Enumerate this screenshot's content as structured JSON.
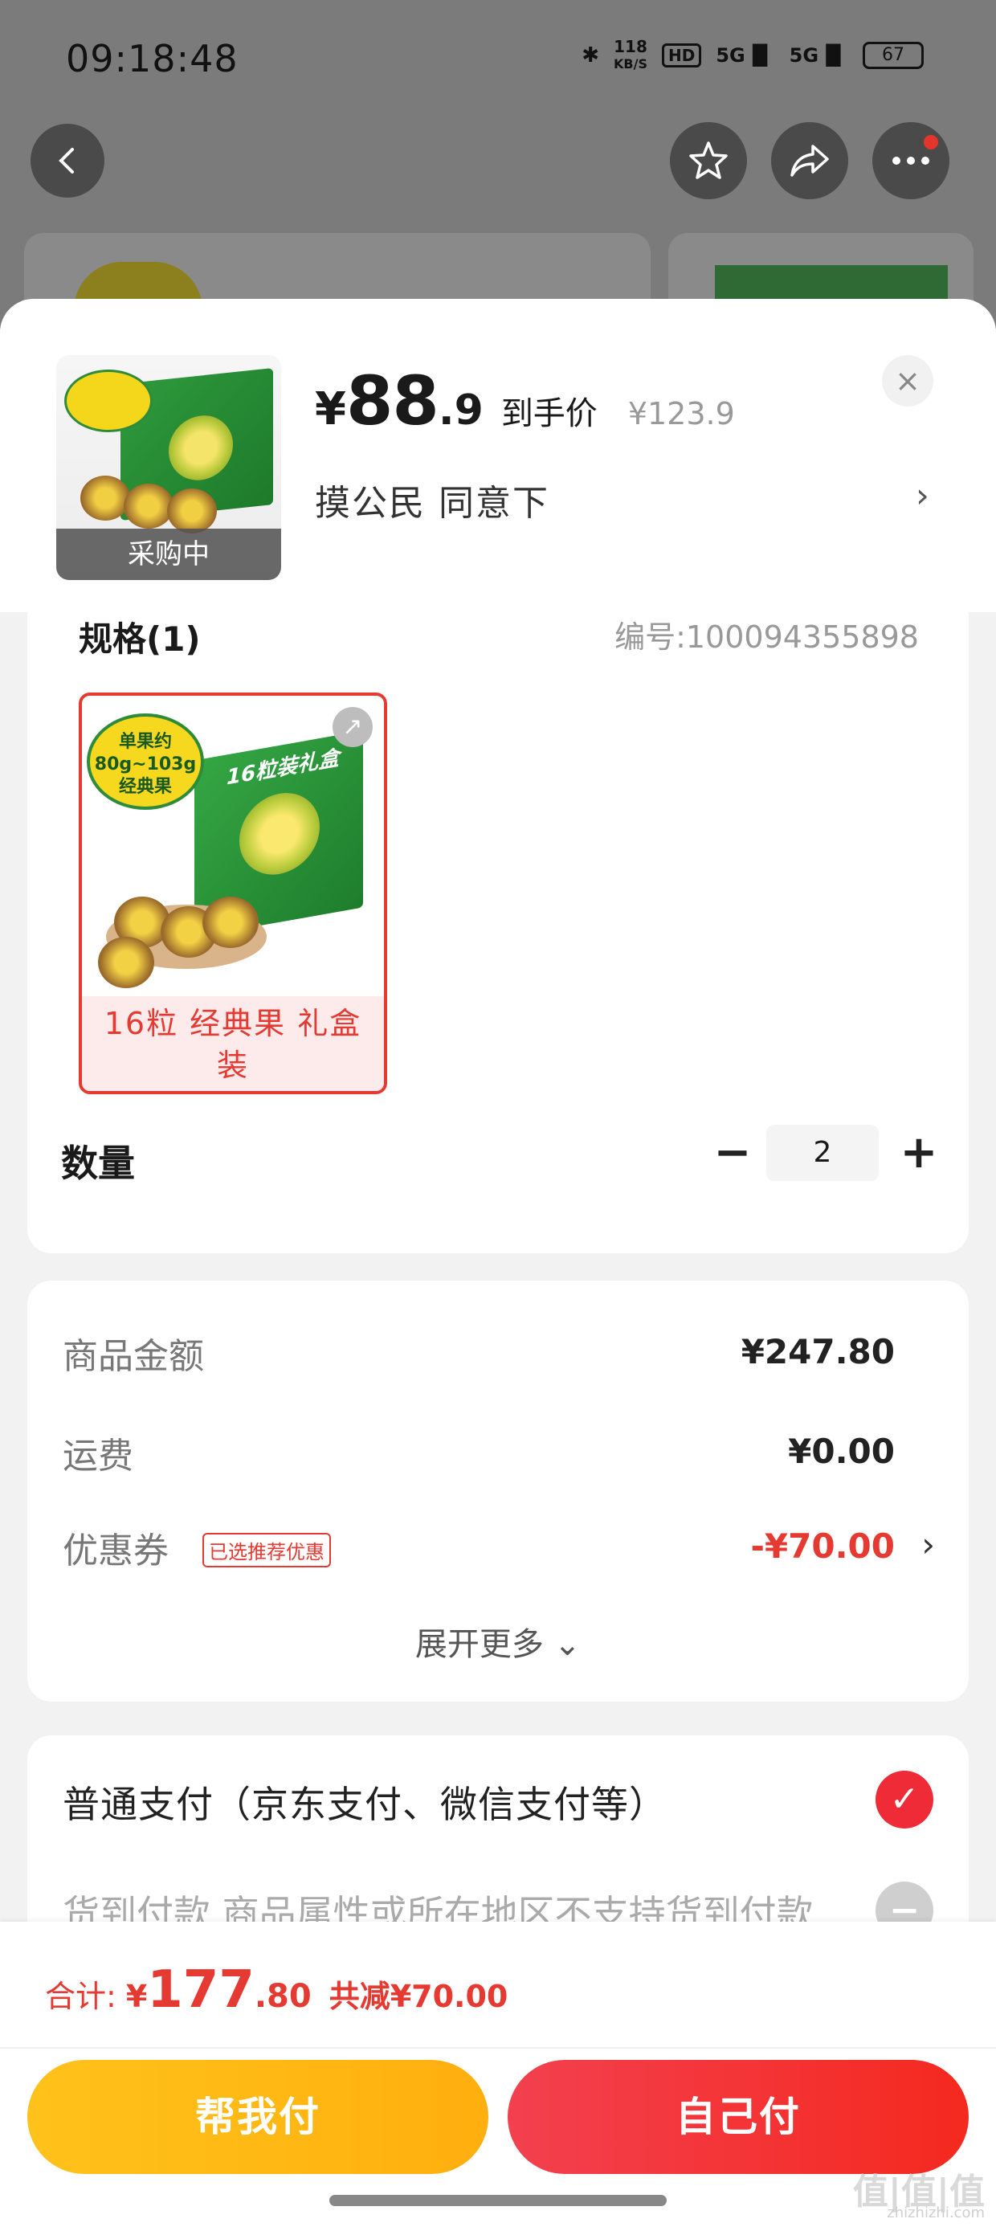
{
  "status_bar": {
    "time": "09:18:48",
    "net_speed": "118",
    "net_unit": "KB/S",
    "hd": "HD",
    "signal1": "5G",
    "signal2": "5G",
    "battery": "67"
  },
  "product": {
    "thumb_tag": "采购中",
    "price_currency": "¥",
    "price_int": "88",
    "price_dec": ".9",
    "price_label": "到手价",
    "original_price": "¥123.9",
    "close": "×",
    "address": "摸公民  同意下",
    "address_arrow": "›"
  },
  "spec": {
    "title": "规格(1)",
    "number": "编号:100094355898",
    "sku_caption": "16粒 经典果 礼盒装",
    "sku_box_text": "16粒装礼盒",
    "sku_badge": "单果约\n80g~103g\n经典果",
    "thumb_badge": "单果约"
  },
  "quantity": {
    "label": "数量",
    "minus": "−",
    "value": "2",
    "plus": "+"
  },
  "amounts": {
    "goods_label": "商品金额",
    "goods_value": "¥247.80",
    "shipping_label": "运费",
    "shipping_value": "¥0.00",
    "coupon_label": "优惠券",
    "coupon_tag": "已选推荐优惠",
    "coupon_value": "-¥70.00",
    "coupon_arrow": "›",
    "expand": "展开更多 ⌄"
  },
  "payment": {
    "option1": "普通支付（京东支付、微信支付等）",
    "option1_check": "✓",
    "option2": "货到付款 商品属性或所在地区不支持货到付款",
    "option2_icon": "−"
  },
  "footer": {
    "total_label": "合计:",
    "total_currency": "¥",
    "total_int": "177",
    "total_dec": ".80",
    "total_saved": "共减¥70.00",
    "btn_help": "帮我付",
    "btn_self": "自己付",
    "watermark": "值|值|值",
    "watermark_sub": "zhizhizhi.com"
  },
  "colors": {
    "accent_red": "#e53a32",
    "help_button": "#ffb813",
    "self_button": "#f3343a"
  }
}
